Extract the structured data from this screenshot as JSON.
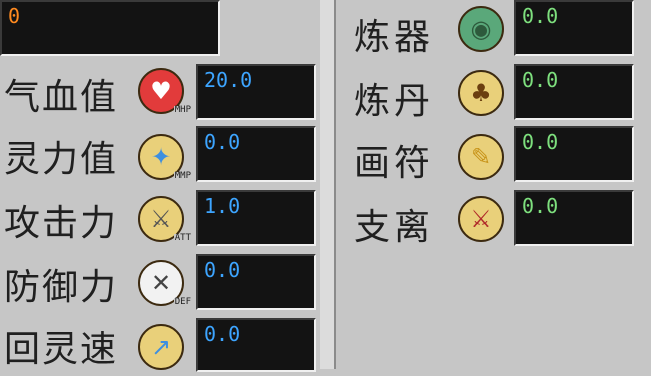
{
  "header": {
    "value": "0"
  },
  "left_stats": [
    {
      "label": "气血值",
      "icon": "heart-icon",
      "icon_sub": "MHP",
      "value": "20.0"
    },
    {
      "label": "灵力值",
      "icon": "spirit-flame-icon",
      "icon_sub": "MMP",
      "value": "0.0"
    },
    {
      "label": "攻击力",
      "icon": "sword-icon",
      "icon_sub": "ATT",
      "value": "1.0"
    },
    {
      "label": "防御力",
      "icon": "shield-icon",
      "icon_sub": "DEF",
      "value": "0.0"
    },
    {
      "label": "回灵速",
      "icon": "regen-arrow-icon",
      "icon_sub": "",
      "value": "0.0"
    }
  ],
  "right_skills": [
    {
      "label": "炼器",
      "icon": "cauldron-icon",
      "value": "0.0"
    },
    {
      "label": "炼丹",
      "icon": "gourd-icon",
      "value": "0.0"
    },
    {
      "label": "画符",
      "icon": "talisman-icon",
      "value": "0.0"
    },
    {
      "label": "支离",
      "icon": "blade-icon",
      "value": "0.0"
    }
  ],
  "colors": {
    "panel": "#c6c6c6",
    "field": "#131313",
    "stat_value": "#3da5ff",
    "skill_value": "#7ee07e",
    "header_value": "#ff8a1f"
  }
}
